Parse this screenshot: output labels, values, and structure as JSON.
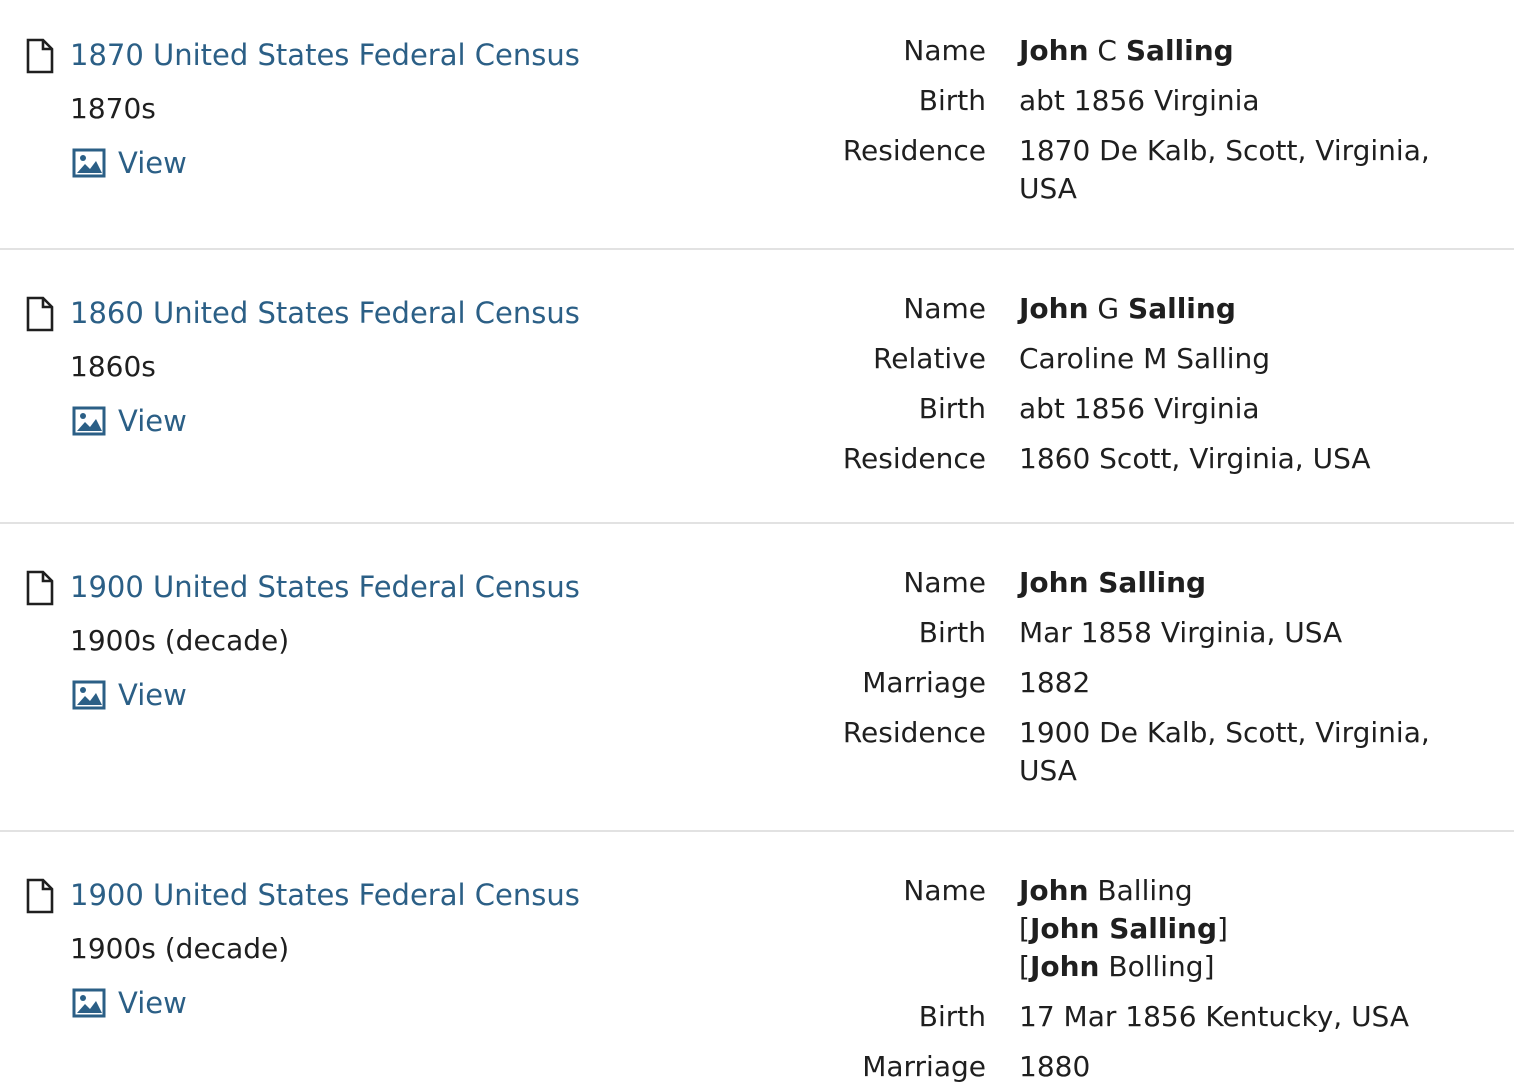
{
  "records": [
    {
      "title": "1870 United States Federal Census",
      "decade": "1870s",
      "view_label": "View",
      "facts": {
        "name_label": "Name",
        "name_given": "John",
        "name_middle": " C ",
        "name_surname": "Salling",
        "birth_label": "Birth",
        "birth_value": "abt 1856 Virginia",
        "residence_label": "Residence",
        "residence_value": "1870 De Kalb, Scott, Virginia, USA"
      }
    },
    {
      "title": "1860 United States Federal Census",
      "decade": "1860s",
      "view_label": "View",
      "facts": {
        "name_label": "Name",
        "name_given": "John",
        "name_middle": " G ",
        "name_surname": "Salling",
        "relative_label": "Relative",
        "relative_value": "Caroline M Salling",
        "birth_label": "Birth",
        "birth_value": "abt 1856 Virginia",
        "residence_label": "Residence",
        "residence_value": "1860 Scott, Virginia, USA"
      }
    },
    {
      "title": "1900 United States Federal Census",
      "decade": "1900s (decade)",
      "view_label": "View",
      "facts": {
        "name_label": "Name",
        "name_full": "John Salling",
        "birth_label": "Birth",
        "birth_value": "Mar 1858 Virginia, USA",
        "marriage_label": "Marriage",
        "marriage_value": "1882",
        "residence_label": "Residence",
        "residence_value": "1900 De Kalb, Scott, Virginia, USA"
      }
    },
    {
      "title": "1900 United States Federal Census",
      "decade": "1900s (decade)",
      "view_label": "View",
      "facts": {
        "name_label": "Name",
        "name_given": "John",
        "name_surname_plain": " Balling",
        "alt1_open": "[",
        "alt1_name": "John Salling",
        "alt1_close": "]",
        "alt2_open": "[",
        "alt2_given": "John",
        "alt2_surname": " Bolling",
        "alt2_close": "]",
        "birth_label": "Birth",
        "birth_value": "17 Mar 1856 Kentucky, USA",
        "marriage_label": "Marriage",
        "marriage_value": "1880"
      }
    }
  ],
  "icons": {
    "record": "document-icon",
    "view": "image-icon"
  },
  "colors": {
    "link": "#2b5f86",
    "text": "#1f1f1f",
    "divider": "#e2e2e2"
  }
}
